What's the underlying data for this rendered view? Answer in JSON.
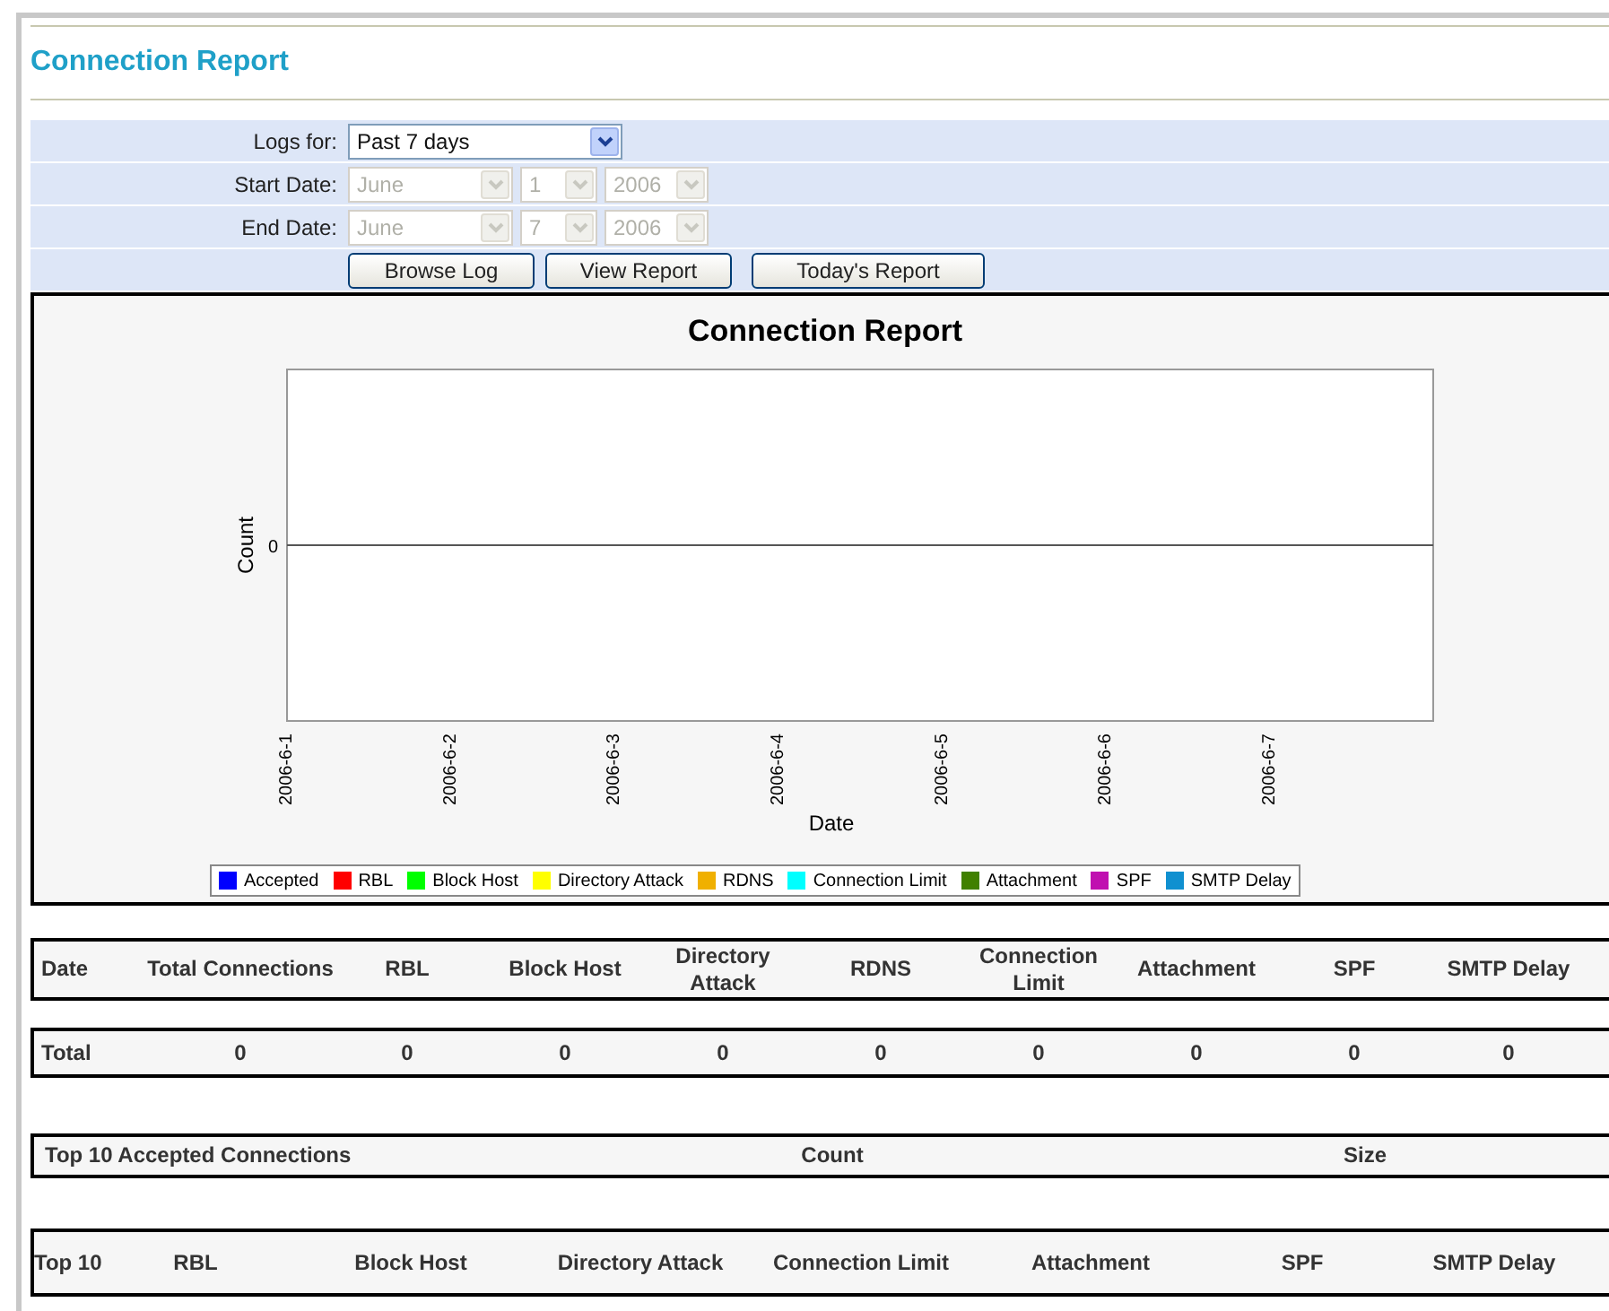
{
  "page_title": "Connection Report",
  "form": {
    "logs_for": {
      "label": "Logs for:",
      "value": "Past 7 days",
      "disabled": false
    },
    "start_date": {
      "label": "Start Date:",
      "month": "June",
      "day": "1",
      "year": "2006",
      "disabled": true
    },
    "end_date": {
      "label": "End Date:",
      "month": "June",
      "day": "7",
      "year": "2006",
      "disabled": true
    },
    "buttons": [
      "Browse Log",
      "View Report",
      "Today's Report"
    ]
  },
  "chart": {
    "title": "Connection Report",
    "xlabel": "Date",
    "ylabel": "Count",
    "categories": [
      "2006-6-1",
      "2006-6-2",
      "2006-6-3",
      "2006-6-4",
      "2006-6-5",
      "2006-6-6",
      "2006-6-7"
    ],
    "y_tick_label": "0",
    "legend": [
      {
        "name": "Accepted",
        "color": "#0000ff"
      },
      {
        "name": "RBL",
        "color": "#ff0000"
      },
      {
        "name": "Block Host",
        "color": "#00ff00"
      },
      {
        "name": "Directory Attack",
        "color": "#ffff00"
      },
      {
        "name": "RDNS",
        "color": "#f0b000"
      },
      {
        "name": "Connection Limit",
        "color": "#00ffff"
      },
      {
        "name": "Attachment",
        "color": "#408000"
      },
      {
        "name": "SPF",
        "color": "#c010b0"
      },
      {
        "name": "SMTP Delay",
        "color": "#1090d0"
      }
    ]
  },
  "summary_table": {
    "columns": [
      "Date",
      "Total Connections",
      "RBL",
      "Block Host",
      "Directory Attack",
      "RDNS",
      "Connection Limit",
      "Attachment",
      "SPF",
      "SMTP Delay"
    ],
    "total_row": [
      "Total",
      "0",
      "0",
      "0",
      "0",
      "0",
      "0",
      "0",
      "0",
      "0"
    ]
  },
  "top_accepted_table": {
    "columns": [
      "Top 10 Accepted Connections",
      "Count",
      "Size"
    ]
  },
  "top_blocked_table": {
    "columns": [
      "Top 10",
      "RBL",
      "Block Host",
      "Directory Attack",
      "Connection Limit",
      "Attachment",
      "SPF",
      "SMTP Delay"
    ]
  }
}
